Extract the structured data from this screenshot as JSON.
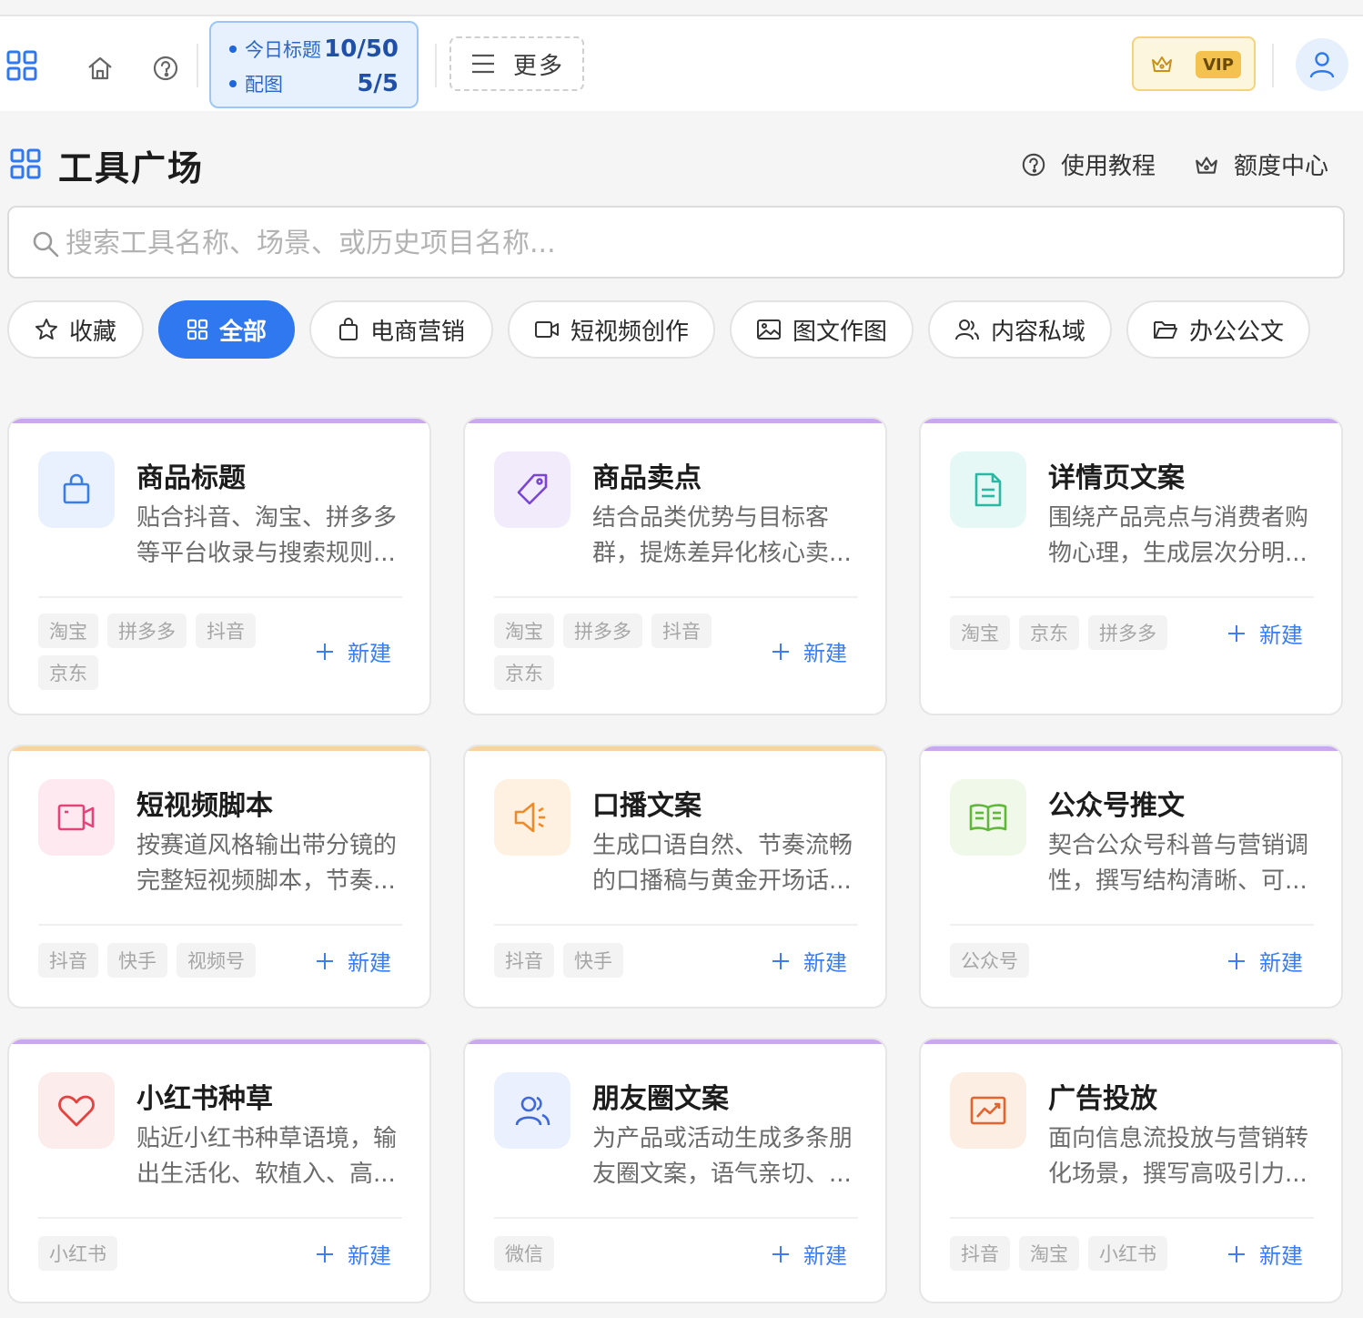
{
  "topbar": {
    "quota": {
      "title_label": "今日标题",
      "title_value": "10/50",
      "image_label": "配图",
      "image_value": "5/5"
    },
    "more_label": "更多",
    "vip_label": "VIP",
    "icons": [
      "grid-icon",
      "home-icon",
      "help-icon",
      "menu-icon",
      "crown-icon",
      "user-icon"
    ]
  },
  "header": {
    "title": "工具广场",
    "tutorial_label": "使用教程",
    "quota_center_label": "额度中心"
  },
  "search": {
    "placeholder": "搜索工具名称、场景、或历史项目名称..."
  },
  "tabs": [
    {
      "label": "收藏",
      "icon": "star-icon"
    },
    {
      "label": "全部",
      "icon": "grid-icon",
      "active": true
    },
    {
      "label": "电商营销",
      "icon": "bag-icon"
    },
    {
      "label": "短视频创作",
      "icon": "video-icon"
    },
    {
      "label": "图文作图",
      "icon": "image-icon"
    },
    {
      "label": "内容私域",
      "icon": "users-icon"
    },
    {
      "label": "办公公文",
      "icon": "folder-icon"
    }
  ],
  "new_label": "新建",
  "colors": {
    "accent": "#2f78ef",
    "purple_bar": "#c9a8ec",
    "orange_bar": "#f6d3a0"
  },
  "cards": [
    {
      "title": "商品标题",
      "desc": "贴合抖音、淘宝、拼多多等平台收录与搜索规则...",
      "tags": [
        "淘宝",
        "拼多多",
        "抖音",
        "京东"
      ],
      "icon": "shopping-bag-icon"
    },
    {
      "title": "商品卖点",
      "desc": "结合品类优势与目标客群，提炼差异化核心卖...",
      "tags": [
        "淘宝",
        "拼多多",
        "抖音",
        "京东"
      ],
      "icon": "price-tag-icon"
    },
    {
      "title": "详情页文案",
      "desc": "围绕产品亮点与消费者购物心理，生成层次分明...",
      "tags": [
        "淘宝",
        "京东",
        "拼多多"
      ],
      "icon": "document-icon"
    },
    {
      "title": "短视频脚本",
      "desc": "按赛道风格输出带分镜的完整短视频脚本，节奏...",
      "tags": [
        "抖音",
        "快手",
        "视频号"
      ],
      "icon": "video-camera-icon"
    },
    {
      "title": "口播文案",
      "desc": "生成口语自然、节奏流畅的口播稿与黄金开场话...",
      "tags": [
        "抖音",
        "快手"
      ],
      "icon": "megaphone-icon"
    },
    {
      "title": "公众号推文",
      "desc": "契合公众号科普与营销调性，撰写结构清晰、可...",
      "tags": [
        "公众号"
      ],
      "icon": "open-book-icon"
    },
    {
      "title": "小红书种草",
      "desc": "贴近小红书种草语境，输出生活化、软植入、高...",
      "tags": [
        "小红书"
      ],
      "icon": "heart-icon"
    },
    {
      "title": "朋友圈文案",
      "desc": "为产品或活动生成多条朋友圈文案，语气亲切、...",
      "tags": [
        "微信"
      ],
      "icon": "users-icon"
    },
    {
      "title": "广告投放",
      "desc": "面向信息流投放与营销转化场景，撰写高吸引力...",
      "tags": [
        "抖音",
        "淘宝",
        "小红书"
      ],
      "icon": "trend-chart-icon"
    }
  ]
}
